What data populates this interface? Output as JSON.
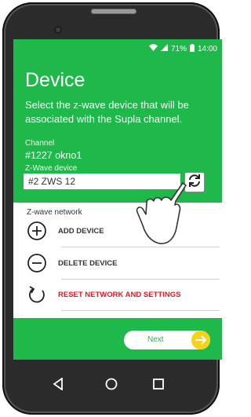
{
  "status": {
    "battery": "71%",
    "time": "14:00"
  },
  "page": {
    "title": "Device",
    "description": "Select the z-wave device that will be associated with the Supla channel.",
    "channel_label": "Channel",
    "channel_value": "#1227 okno1",
    "zwave_label": "Z-Wave device",
    "zwave_value": "#2 ZWS 12"
  },
  "network": {
    "title": "Z-wave network",
    "items": [
      {
        "label": "ADD DEVICE",
        "icon": "plus-circle-icon"
      },
      {
        "label": "DELETE DEVICE",
        "icon": "minus-circle-icon"
      },
      {
        "label": "RESET NETWORK AND SETTINGS",
        "icon": "reset-icon",
        "color": "#e01b24"
      }
    ]
  },
  "next_label": "Next",
  "colors": {
    "accent": "#1fb84a",
    "yellow": "#f5d21c",
    "danger": "#e01b24"
  },
  "nav": [
    "back-icon",
    "home-icon",
    "recents-icon"
  ]
}
